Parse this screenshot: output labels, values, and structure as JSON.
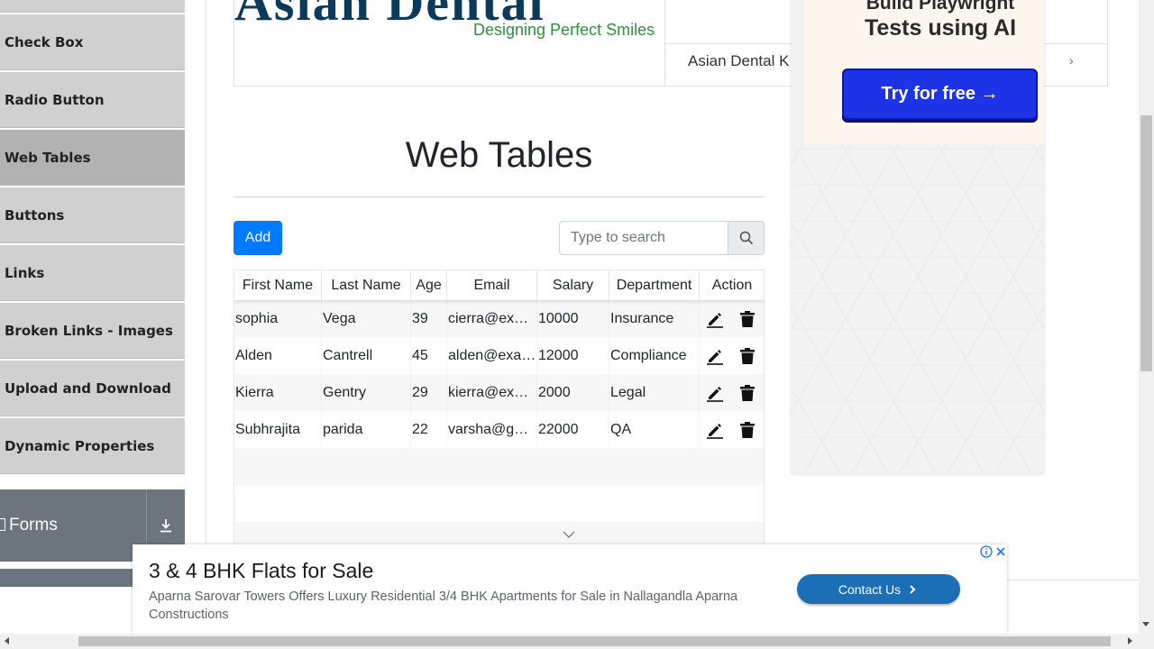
{
  "sidebar": {
    "items": [
      {
        "label": "Check Box",
        "name": "sidebar-item-check-box",
        "active": false
      },
      {
        "label": "Radio Button",
        "name": "sidebar-item-radio-button",
        "active": false
      },
      {
        "label": "Web Tables",
        "name": "sidebar-item-web-tables",
        "active": true
      },
      {
        "label": "Buttons",
        "name": "sidebar-item-buttons",
        "active": false
      },
      {
        "label": "Links",
        "name": "sidebar-item-links",
        "active": false
      },
      {
        "label": "Broken Links - Images",
        "name": "sidebar-item-broken-links",
        "active": false
      },
      {
        "label": "Upload and Download",
        "name": "sidebar-item-upload-download",
        "active": false
      },
      {
        "label": "Dynamic Properties",
        "name": "sidebar-item-dynamic-properties",
        "active": false
      }
    ],
    "forms_group": {
      "label": "Forms",
      "icon": "download-arrow-icon"
    }
  },
  "banner_ad": {
    "logo_text": "Asian Dental",
    "tagline": "Designing Perfect Smiles",
    "side_name": "Asian Dental K",
    "arrow": "›"
  },
  "side_ad": {
    "line1": "Build Playwright",
    "line2": "Tests using AI",
    "button": "Try for free →"
  },
  "main": {
    "title": "Web Tables",
    "add_label": "Add",
    "search_placeholder": "Type to search"
  },
  "table": {
    "headers": [
      "First Name",
      "Last Name",
      "Age",
      "Email",
      "Salary",
      "Department",
      "Action"
    ],
    "rows": [
      [
        "sophia",
        "Vega",
        "39",
        "cierra@example.com",
        "10000",
        "Insurance"
      ],
      [
        "Alden",
        "Cantrell",
        "45",
        "alden@example.com",
        "12000",
        "Compliance"
      ],
      [
        "Kierra",
        "Gentry",
        "29",
        "kierra@example.com",
        "2000",
        "Legal"
      ],
      [
        "Subhrajita",
        "parida",
        "22",
        "varsha@gmail.com",
        "22000",
        "QA"
      ]
    ],
    "empty_rows": 3
  },
  "bottom_ad": {
    "headline": "3 & 4 BHK Flats for Sale",
    "description": "Aparna Sarovar Towers Offers Luxury Residential 3/4 BHK Apartments for Sale in Nallagandla Aparna Constructions",
    "cta": "Contact Us"
  },
  "colors": {
    "primary": "#007bff",
    "sidebar_bg": "#d0d0d0",
    "sidebar_active": "#b2b2b2",
    "group_header": "#6c757d",
    "cta_blue": "#1a6fb7",
    "promo_blue": "#1c33e6"
  }
}
